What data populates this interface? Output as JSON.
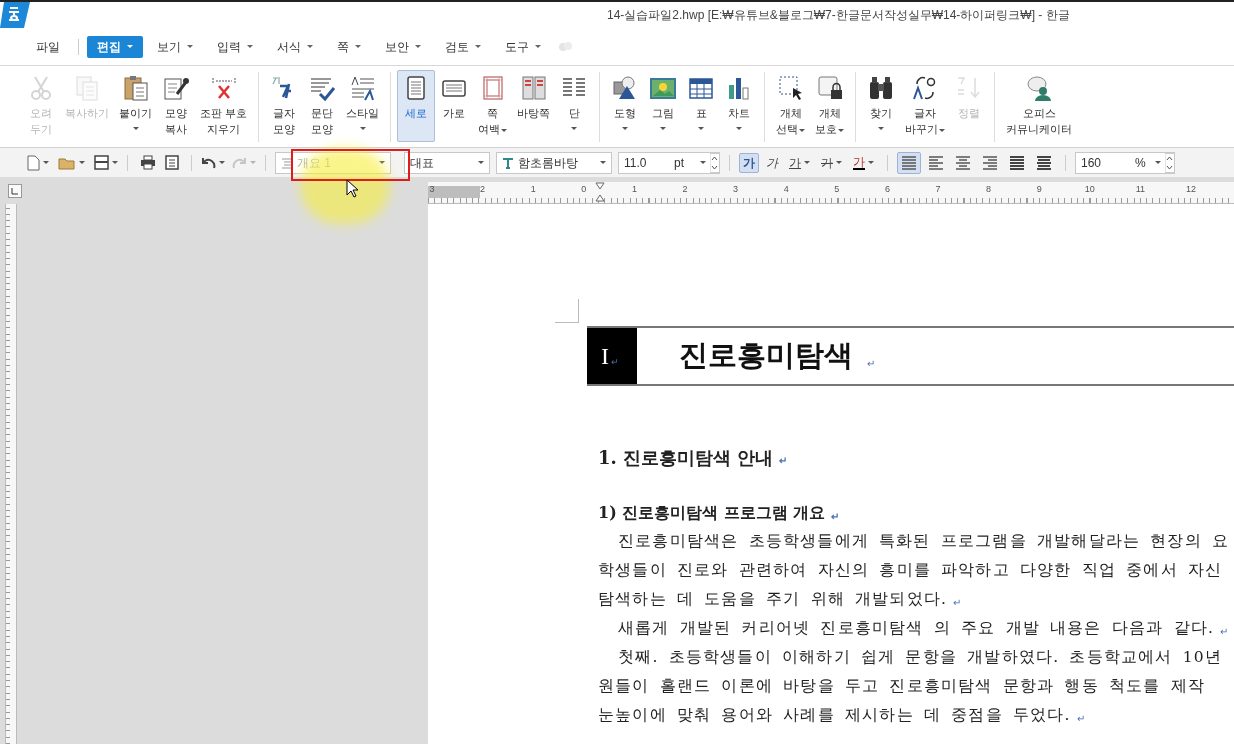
{
  "window": {
    "title": "14-실습파일2.hwp [E:₩유튜브&블로그₩7-한글문서작성실무₩14-하이퍼링크₩] - 한글"
  },
  "menu": [
    {
      "label": "파일",
      "selected": false,
      "dropdown": false
    },
    {
      "label": "편집",
      "selected": true,
      "dropdown": true
    },
    {
      "label": "보기",
      "selected": false,
      "dropdown": true
    },
    {
      "label": "입력",
      "selected": false,
      "dropdown": true
    },
    {
      "label": "서식",
      "selected": false,
      "dropdown": true
    },
    {
      "label": "쪽",
      "selected": false,
      "dropdown": true
    },
    {
      "label": "보안",
      "selected": false,
      "dropdown": true
    },
    {
      "label": "검토",
      "selected": false,
      "dropdown": true
    },
    {
      "label": "도구",
      "selected": false,
      "dropdown": true
    }
  ],
  "ribbon": [
    [
      {
        "label": "오려\n두기",
        "disabled": true,
        "selected": false,
        "dropdown": false
      },
      {
        "label": "복사하기",
        "disabled": true,
        "selected": false,
        "dropdown": false
      },
      {
        "label": "붙이기",
        "disabled": false,
        "selected": false,
        "dropdown": true
      },
      {
        "label": "모양\n복사",
        "disabled": false,
        "selected": false,
        "dropdown": false
      },
      {
        "label": "조판 부호\n지우기",
        "disabled": false,
        "selected": false,
        "dropdown": false
      }
    ],
    [
      {
        "label": "글자\n모양",
        "disabled": false,
        "selected": false,
        "dropdown": false
      },
      {
        "label": "문단\n모양",
        "disabled": false,
        "selected": false,
        "dropdown": false
      },
      {
        "label": "스타일",
        "disabled": false,
        "selected": false,
        "dropdown": true
      }
    ],
    [
      {
        "label": "세로",
        "disabled": false,
        "selected": true,
        "dropdown": false
      },
      {
        "label": "가로",
        "disabled": false,
        "selected": false,
        "dropdown": false
      },
      {
        "label": "쪽\n여백",
        "disabled": false,
        "selected": false,
        "dropdown": true
      },
      {
        "label": "바탕쪽",
        "disabled": false,
        "selected": false,
        "dropdown": false
      },
      {
        "label": "단",
        "disabled": false,
        "selected": false,
        "dropdown": true
      }
    ],
    [
      {
        "label": "도형",
        "disabled": false,
        "selected": false,
        "dropdown": true
      },
      {
        "label": "그림",
        "disabled": false,
        "selected": false,
        "dropdown": true
      },
      {
        "label": "표",
        "disabled": false,
        "selected": false,
        "dropdown": true
      },
      {
        "label": "차트",
        "disabled": false,
        "selected": false,
        "dropdown": true
      }
    ],
    [
      {
        "label": "개체\n선택",
        "disabled": false,
        "selected": false,
        "dropdown": true
      },
      {
        "label": "개체\n보호",
        "disabled": false,
        "selected": false,
        "dropdown": true
      }
    ],
    [
      {
        "label": "찾기",
        "disabled": false,
        "selected": false,
        "dropdown": true
      },
      {
        "label": "글자\n바꾸기",
        "disabled": false,
        "selected": false,
        "dropdown": true
      },
      {
        "label": "정렬",
        "disabled": true,
        "selected": false,
        "dropdown": false
      }
    ],
    [
      {
        "label": "오피스\n커뮤니케이터",
        "disabled": false,
        "selected": false,
        "dropdown": false
      }
    ]
  ],
  "toolbar": {
    "style_field": {
      "value": "개요 1",
      "disabled": true
    },
    "paragraph_style": {
      "value": "대표"
    },
    "font": {
      "value": "함초롬바탕"
    },
    "size": {
      "value": "11.0",
      "unit": "pt"
    },
    "char_buttons": [
      {
        "label": "가",
        "selected": true,
        "dropdown": false
      },
      {
        "label": "가",
        "selected": false,
        "dropdown": false
      },
      {
        "label": "가",
        "selected": false,
        "dropdown": true
      },
      {
        "label": "가",
        "selected": false,
        "dropdown": true
      },
      {
        "label": "가",
        "selected": false,
        "dropdown": true
      }
    ],
    "align_buttons": [
      {
        "selected": true
      },
      {
        "selected": false
      },
      {
        "selected": false
      },
      {
        "selected": false
      },
      {
        "selected": false
      },
      {
        "selected": false
      }
    ],
    "zoom": {
      "value": "160",
      "unit": "%"
    }
  },
  "ruler": {
    "labels": [
      "3",
      "2",
      "1",
      "0",
      "1",
      "2",
      "3",
      "4",
      "5",
      "6",
      "7",
      "8",
      "9",
      "10",
      "11",
      "12"
    ]
  },
  "document": {
    "heading": {
      "number": "I",
      "text": "진로흥미탐색",
      "mark": "↵"
    },
    "blocks": [
      {
        "kind": "h1",
        "text": "1. 진로흥미탐색 안내",
        "mark": "↵",
        "indent": false
      },
      {
        "kind": "h2",
        "text": "1) 진로흥미탐색 프로그램 개요",
        "mark": "↵",
        "indent": false
      },
      {
        "kind": "body",
        "text": "진로흥미탐색은 초등학생들에게 특화된 프로그램을 개발해달라는 현장의 요",
        "indent": true
      },
      {
        "kind": "body",
        "text": "학생들이 진로와 관련하여 자신의 흥미를 파악하고 다양한 직업 중에서 자신",
        "indent": false
      },
      {
        "kind": "body",
        "text": "탐색하는 데 도움을 주기 위해 개발되었다.",
        "mark": "↵",
        "indent": false
      },
      {
        "kind": "body",
        "text": "새롭게 개발된 커리어넷 진로흥미탐색 의 주요 개발 내용은 다음과 같다.",
        "mark": "↵",
        "indent": true
      },
      {
        "kind": "body",
        "text": "첫째. 초등학생들이 이해하기 쉽게 문항을 개발하였다. 초등학교에서 10년",
        "indent": true
      },
      {
        "kind": "body",
        "text": "원들이 홀랜드 이론에 바탕을 두고 진로흥미탐색 문항과 행동 척도를 제작",
        "indent": false
      },
      {
        "kind": "body",
        "text": "눈높이에 맞춰 용어와 사례를 제시하는 데 중점을 두었다.",
        "mark": "↵",
        "indent": false
      }
    ]
  }
}
